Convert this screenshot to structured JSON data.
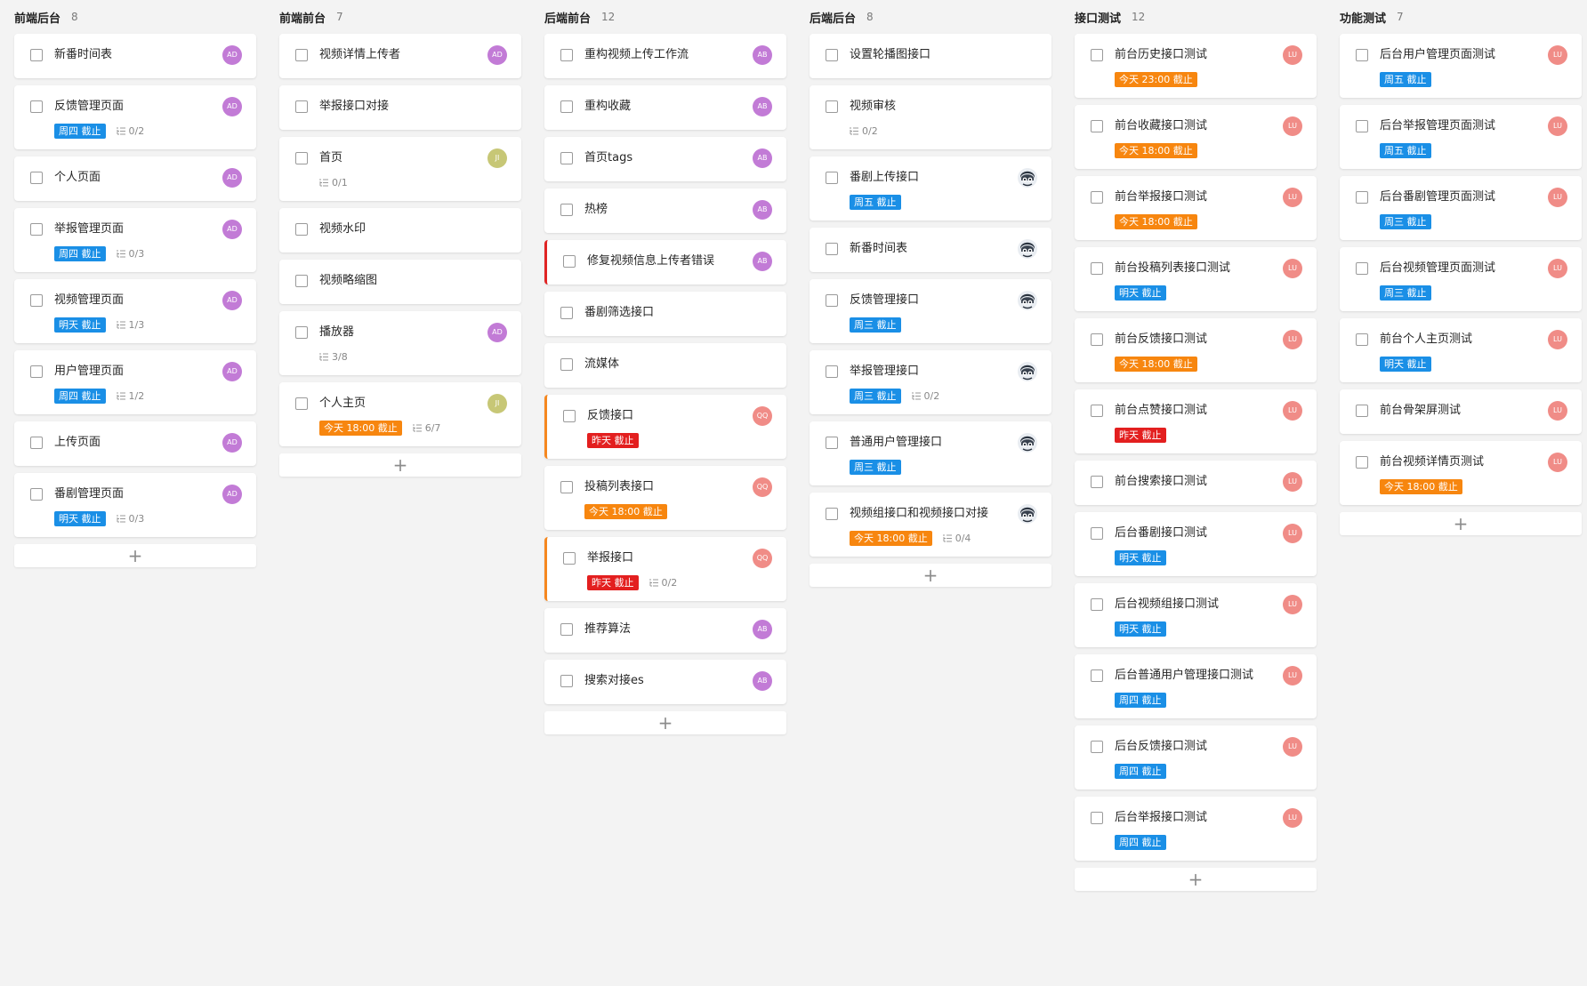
{
  "colors": {
    "blue": "#1a8fe6",
    "orange": "#f7860f",
    "red": "#e31f1f",
    "purple": "#c27bd6",
    "olive": "#c7c776",
    "salmon": "#f08c87"
  },
  "add_symbol": "+",
  "columns": [
    {
      "title": "前端后台",
      "count": "8",
      "cards": [
        {
          "title": "新番时间表",
          "avatar": "AD",
          "avatar_color": "#c27bd6"
        },
        {
          "title": "反馈管理页面",
          "avatar": "AD",
          "avatar_color": "#c27bd6",
          "due": "周四 截止",
          "due_color": "#1a8fe6",
          "subtasks": "0/2"
        },
        {
          "title": "个人页面",
          "avatar": "AD",
          "avatar_color": "#c27bd6"
        },
        {
          "title": "举报管理页面",
          "avatar": "AD",
          "avatar_color": "#c27bd6",
          "due": "周四 截止",
          "due_color": "#1a8fe6",
          "subtasks": "0/3"
        },
        {
          "title": "视频管理页面",
          "avatar": "AD",
          "avatar_color": "#c27bd6",
          "due": "明天 截止",
          "due_color": "#1a8fe6",
          "subtasks": "1/3"
        },
        {
          "title": "用户管理页面",
          "avatar": "AD",
          "avatar_color": "#c27bd6",
          "due": "周四 截止",
          "due_color": "#1a8fe6",
          "subtasks": "1/2"
        },
        {
          "title": "上传页面",
          "avatar": "AD",
          "avatar_color": "#c27bd6"
        },
        {
          "title": "番剧管理页面",
          "avatar": "AD",
          "avatar_color": "#c27bd6",
          "due": "明天 截止",
          "due_color": "#1a8fe6",
          "subtasks": "0/3"
        }
      ]
    },
    {
      "title": "前端前台",
      "count": "7",
      "cards": [
        {
          "title": "视频详情上传者",
          "avatar": "AD",
          "avatar_color": "#c27bd6"
        },
        {
          "title": "举报接口对接"
        },
        {
          "title": "首页",
          "avatar": "JI",
          "avatar_color": "#c7c776",
          "subtasks": "0/1"
        },
        {
          "title": "视频水印"
        },
        {
          "title": "视频略缩图"
        },
        {
          "title": "播放器",
          "avatar": "AD",
          "avatar_color": "#c27bd6",
          "subtasks": "3/8"
        },
        {
          "title": "个人主页",
          "avatar": "JI",
          "avatar_color": "#c7c776",
          "due": "今天 18:00 截止",
          "due_color": "#f7860f",
          "subtasks": "6/7"
        }
      ]
    },
    {
      "title": "后端前台",
      "count": "12",
      "cards": [
        {
          "title": "重构视频上传工作流",
          "avatar": "AB",
          "avatar_color": "#c27bd6"
        },
        {
          "title": "重构收藏",
          "avatar": "AB",
          "avatar_color": "#c27bd6"
        },
        {
          "title": "首页tags",
          "avatar": "AB",
          "avatar_color": "#c27bd6"
        },
        {
          "title": "热榜",
          "avatar": "AB",
          "avatar_color": "#c27bd6"
        },
        {
          "title": "修复视频信息上传者错误",
          "avatar": "AB",
          "avatar_color": "#c27bd6",
          "accent": "red"
        },
        {
          "title": "番剧筛选接口"
        },
        {
          "title": "流媒体"
        },
        {
          "title": "反馈接口",
          "avatar": "QQ",
          "avatar_color": "#f08c87",
          "accent": "orange",
          "due": "昨天 截止",
          "due_color": "#e31f1f"
        },
        {
          "title": "投稿列表接口",
          "avatar": "QQ",
          "avatar_color": "#f08c87",
          "due": "今天 18:00 截止",
          "due_color": "#f7860f"
        },
        {
          "title": "举报接口",
          "avatar": "QQ",
          "avatar_color": "#f08c87",
          "accent": "orange",
          "due": "昨天 截止",
          "due_color": "#e31f1f",
          "subtasks": "0/2"
        },
        {
          "title": "推荐算法",
          "avatar": "AB",
          "avatar_color": "#c27bd6"
        },
        {
          "title": "搜索对接es",
          "avatar": "AB",
          "avatar_color": "#c27bd6"
        }
      ]
    },
    {
      "title": "后端后台",
      "count": "8",
      "cards": [
        {
          "title": "设置轮播图接口"
        },
        {
          "title": "视频审核",
          "subtasks": "0/2"
        },
        {
          "title": "番剧上传接口",
          "avatar_photo": true,
          "due": "周五 截止",
          "due_color": "#1a8fe6"
        },
        {
          "title": "新番时间表",
          "avatar_photo": true
        },
        {
          "title": "反馈管理接口",
          "avatar_photo": true,
          "due": "周三 截止",
          "due_color": "#1a8fe6"
        },
        {
          "title": "举报管理接口",
          "avatar_photo": true,
          "due": "周三 截止",
          "due_color": "#1a8fe6",
          "subtasks": "0/2"
        },
        {
          "title": "普通用户管理接口",
          "avatar_photo": true,
          "due": "周三 截止",
          "due_color": "#1a8fe6"
        },
        {
          "title": "视频组接口和视频接口对接",
          "avatar_photo": true,
          "due": "今天 18:00 截止",
          "due_color": "#f7860f",
          "subtasks": "0/4"
        }
      ]
    },
    {
      "title": "接口测试",
      "count": "12",
      "cards": [
        {
          "title": "前台历史接口测试",
          "avatar": "LU",
          "avatar_color": "#f08c87",
          "due": "今天 23:00 截止",
          "due_color": "#f7860f"
        },
        {
          "title": "前台收藏接口测试",
          "avatar": "LU",
          "avatar_color": "#f08c87",
          "due": "今天 18:00 截止",
          "due_color": "#f7860f"
        },
        {
          "title": "前台举报接口测试",
          "avatar": "LU",
          "avatar_color": "#f08c87",
          "due": "今天 18:00 截止",
          "due_color": "#f7860f"
        },
        {
          "title": "前台投稿列表接口测试",
          "avatar": "LU",
          "avatar_color": "#f08c87",
          "due": "明天 截止",
          "due_color": "#1a8fe6"
        },
        {
          "title": "前台反馈接口测试",
          "avatar": "LU",
          "avatar_color": "#f08c87",
          "due": "今天 18:00 截止",
          "due_color": "#f7860f"
        },
        {
          "title": "前台点赞接口测试",
          "avatar": "LU",
          "avatar_color": "#f08c87",
          "due": "昨天 截止",
          "due_color": "#e31f1f"
        },
        {
          "title": "前台搜索接口测试",
          "avatar": "LU",
          "avatar_color": "#f08c87"
        },
        {
          "title": "后台番剧接口测试",
          "avatar": "LU",
          "avatar_color": "#f08c87",
          "due": "明天 截止",
          "due_color": "#1a8fe6"
        },
        {
          "title": "后台视频组接口测试",
          "avatar": "LU",
          "avatar_color": "#f08c87",
          "due": "明天 截止",
          "due_color": "#1a8fe6"
        },
        {
          "title": "后台普通用户管理接口测试",
          "avatar": "LU",
          "avatar_color": "#f08c87",
          "due": "周四 截止",
          "due_color": "#1a8fe6"
        },
        {
          "title": "后台反馈接口测试",
          "avatar": "LU",
          "avatar_color": "#f08c87",
          "due": "周四 截止",
          "due_color": "#1a8fe6"
        },
        {
          "title": "后台举报接口测试",
          "avatar": "LU",
          "avatar_color": "#f08c87",
          "due": "周四 截止",
          "due_color": "#1a8fe6"
        }
      ]
    },
    {
      "title": "功能测试",
      "count": "7",
      "cards": [
        {
          "title": "后台用户管理页面测试",
          "avatar": "LU",
          "avatar_color": "#f08c87",
          "due": "周五 截止",
          "due_color": "#1a8fe6"
        },
        {
          "title": "后台举报管理页面测试",
          "avatar": "LU",
          "avatar_color": "#f08c87",
          "due": "周五 截止",
          "due_color": "#1a8fe6"
        },
        {
          "title": "后台番剧管理页面测试",
          "avatar": "LU",
          "avatar_color": "#f08c87",
          "due": "周三 截止",
          "due_color": "#1a8fe6"
        },
        {
          "title": "后台视频管理页面测试",
          "avatar": "LU",
          "avatar_color": "#f08c87",
          "due": "周三 截止",
          "due_color": "#1a8fe6"
        },
        {
          "title": "前台个人主页测试",
          "avatar": "LU",
          "avatar_color": "#f08c87",
          "due": "明天 截止",
          "due_color": "#1a8fe6"
        },
        {
          "title": "前台骨架屏测试",
          "avatar": "LU",
          "avatar_color": "#f08c87"
        },
        {
          "title": "前台视频详情页测试",
          "avatar": "LU",
          "avatar_color": "#f08c87",
          "due": "今天 18:00 截止",
          "due_color": "#f7860f"
        }
      ]
    }
  ]
}
